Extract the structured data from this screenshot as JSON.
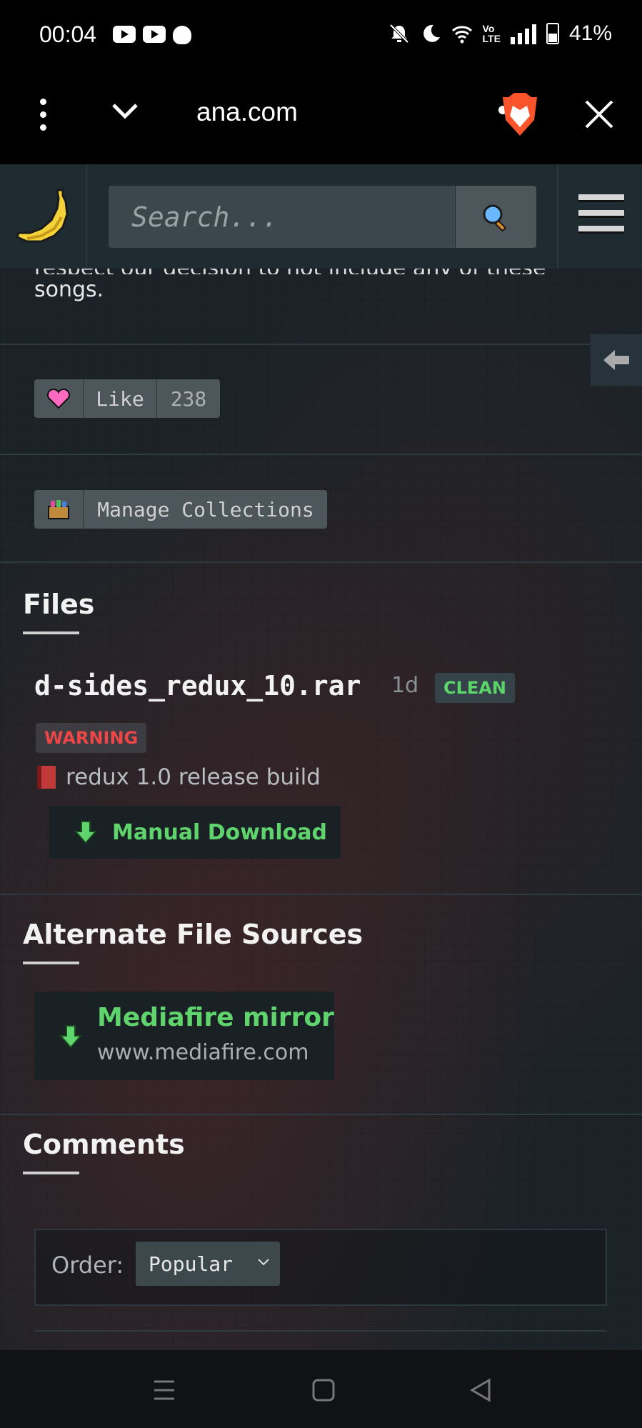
{
  "status_bar": {
    "time": "00:04",
    "battery": "41%",
    "icons": [
      "youtube-icon",
      "youtube-icon",
      "reddit-icon",
      "notifications-off-icon",
      "moon-icon",
      "wifi-icon",
      "volte-icon",
      "signal-icon",
      "battery-icon"
    ]
  },
  "browser": {
    "url": "ana.com",
    "menu_icon": "kebab-menu-icon",
    "collapse_icon": "chevron-down-icon",
    "brave_icon": "brave-lion-icon",
    "close_icon": "close-icon"
  },
  "site_header": {
    "logo_icon": "banana-icon",
    "search_placeholder": "Search...",
    "search_icon": "magnifier-icon",
    "menu_icon": "hamburger-icon"
  },
  "content": {
    "cut_text_top": "respect our decision to not include any of these",
    "cut_text_bottom": "songs.",
    "like": {
      "label": "Like",
      "count": "238"
    },
    "collections": {
      "label": "Manage Collections"
    },
    "files_heading": "Files",
    "file": {
      "name": "d-sides_redux_10.rar",
      "age": "1d",
      "clean_badge": "CLEAN",
      "warning_badge": "WARNING",
      "description": "redux 1.0 release build",
      "download_label": "Manual Download"
    },
    "alt_heading": "Alternate File Sources",
    "mirror": {
      "title": "Mediafire mirror",
      "url": "www.mediafire.com"
    },
    "comments_heading": "Comments",
    "order": {
      "label": "Order:",
      "selected": "Popular"
    }
  },
  "colors": {
    "accent_green": "#5fd36c",
    "warning_red": "#ee4646",
    "header_bg": "#1e2b31"
  }
}
